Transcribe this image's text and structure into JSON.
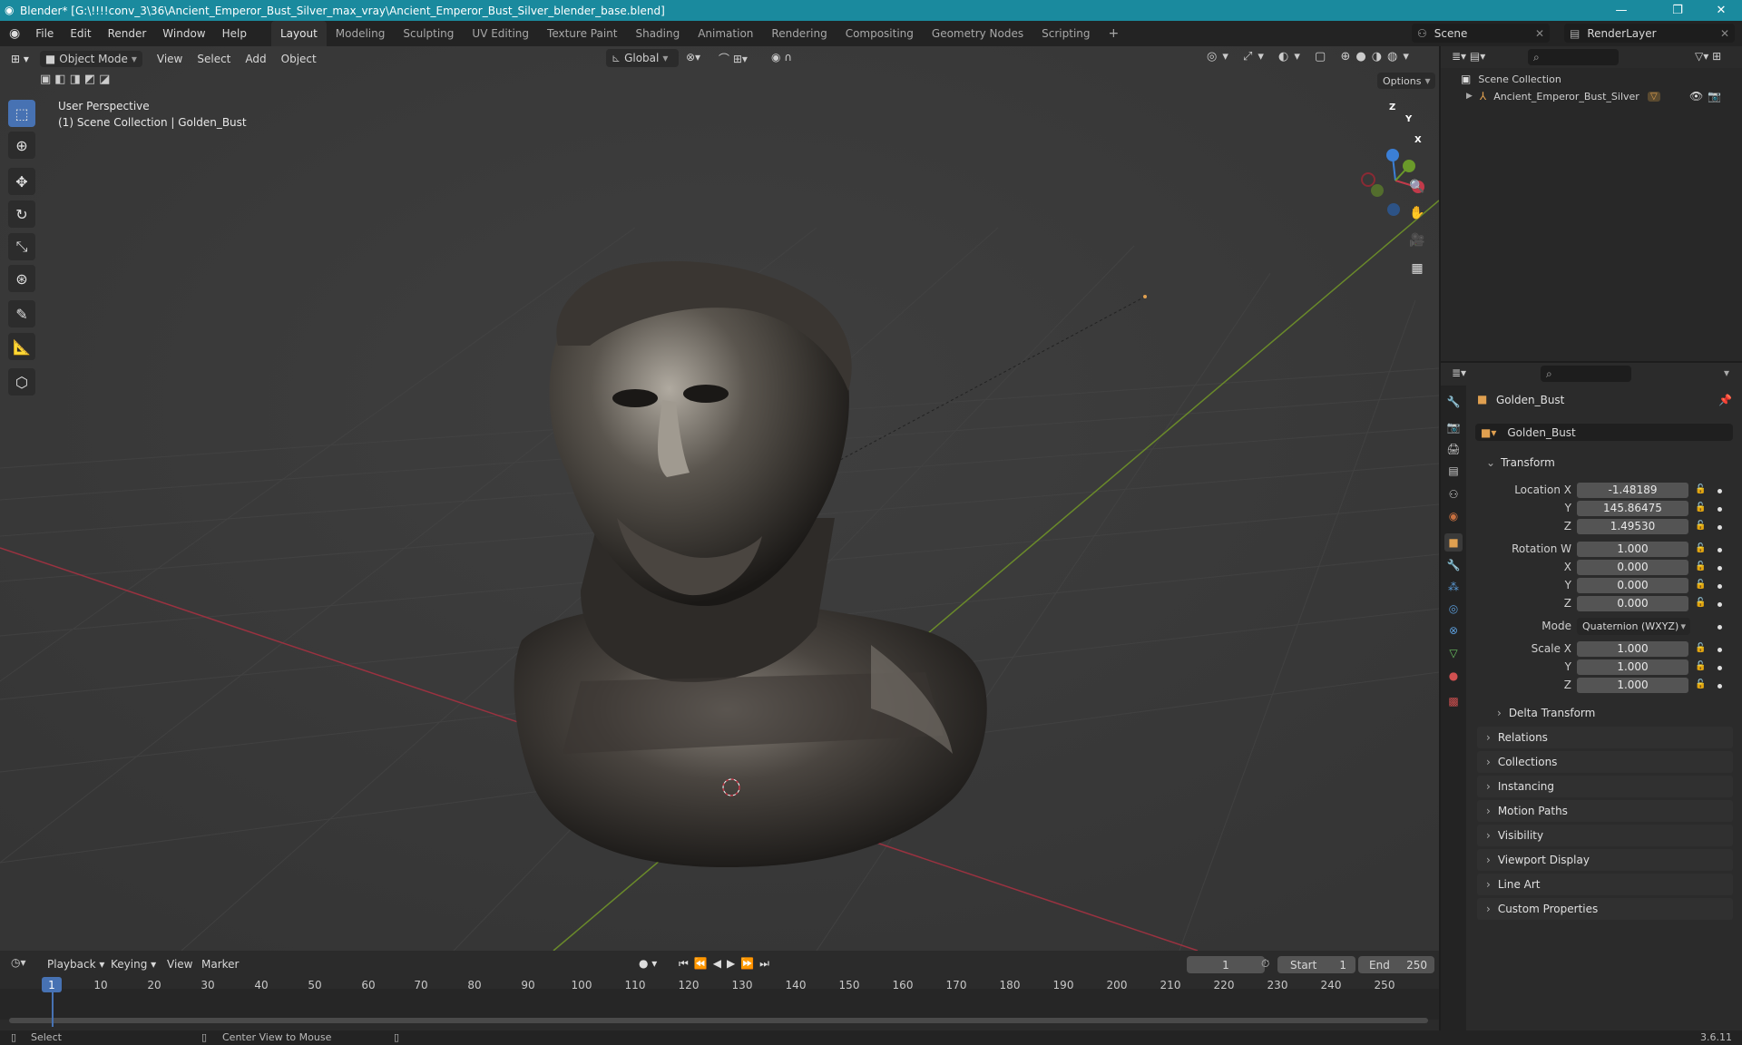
{
  "window": {
    "title": "Blender* [G:\\!!!!conv_3\\36\\Ancient_Emperor_Bust_Silver_max_vray\\Ancient_Emperor_Bust_Silver_blender_base.blend]",
    "minimize": "—",
    "maximize": "❐",
    "close": "✕"
  },
  "menu": {
    "items": [
      "File",
      "Edit",
      "Render",
      "Window",
      "Help"
    ],
    "workspaces": [
      "Layout",
      "Modeling",
      "Sculpting",
      "UV Editing",
      "Texture Paint",
      "Shading",
      "Animation",
      "Rendering",
      "Compositing",
      "Geometry Nodes",
      "Scripting"
    ],
    "add_workspace": "+",
    "scene": "Scene",
    "view_layer": "RenderLayer"
  },
  "viewport": {
    "mode": "Object Mode",
    "menus": [
      "View",
      "Select",
      "Add",
      "Object"
    ],
    "orientation": "Global",
    "options": "Options",
    "overlay_title": "User Perspective",
    "overlay_subtitle": "(1) Scene Collection | Golden_Bust",
    "gizmo_axes": {
      "x": "X",
      "y": "Y",
      "z": "Z"
    }
  },
  "outliner": {
    "root": "Scene Collection",
    "items": [
      {
        "label": "Ancient_Emperor_Bust_Silver"
      }
    ]
  },
  "properties": {
    "object_name": "Golden_Bust",
    "data_name": "Golden_Bust",
    "transform_title": "Transform",
    "location_label": "Location X",
    "location": {
      "x": "-1.48189",
      "y": "145.86475",
      "z": "1.49530"
    },
    "rotation_label": "Rotation W",
    "rotation": {
      "w": "1.000",
      "x": "0.000",
      "y": "0.000",
      "z": "0.000"
    },
    "mode_label": "Mode",
    "mode_value": "Quaternion (WXYZ)",
    "scale_label": "Scale X",
    "scale": {
      "x": "1.000",
      "y": "1.000",
      "z": "1.000"
    },
    "axis_labels": {
      "x": "X",
      "y": "Y",
      "z": "Z"
    },
    "delta": "Delta Transform",
    "panels": [
      "Relations",
      "Collections",
      "Instancing",
      "Motion Paths",
      "Visibility",
      "Viewport Display",
      "Line Art",
      "Custom Properties"
    ]
  },
  "timeline": {
    "menus": [
      "Playback",
      "Keying",
      "View",
      "Marker"
    ],
    "current_frame": "1",
    "start_label": "Start",
    "start": "1",
    "end_label": "End",
    "end": "250",
    "ticks": [
      "1",
      "10",
      "20",
      "30",
      "40",
      "50",
      "60",
      "70",
      "80",
      "90",
      "100",
      "110",
      "120",
      "130",
      "140",
      "150",
      "160",
      "170",
      "180",
      "190",
      "200",
      "210",
      "220",
      "230",
      "240",
      "250"
    ]
  },
  "status": {
    "select": "Select",
    "center": "Center View to Mouse",
    "version": "3.6.11"
  },
  "colors": {
    "titlebar": "#1a8a9e",
    "accent": "#4772b3",
    "x_axis": "#c23a4a",
    "y_axis": "#6a9a2a",
    "z_axis": "#3b7fd6",
    "playhead": "#4772b3"
  }
}
